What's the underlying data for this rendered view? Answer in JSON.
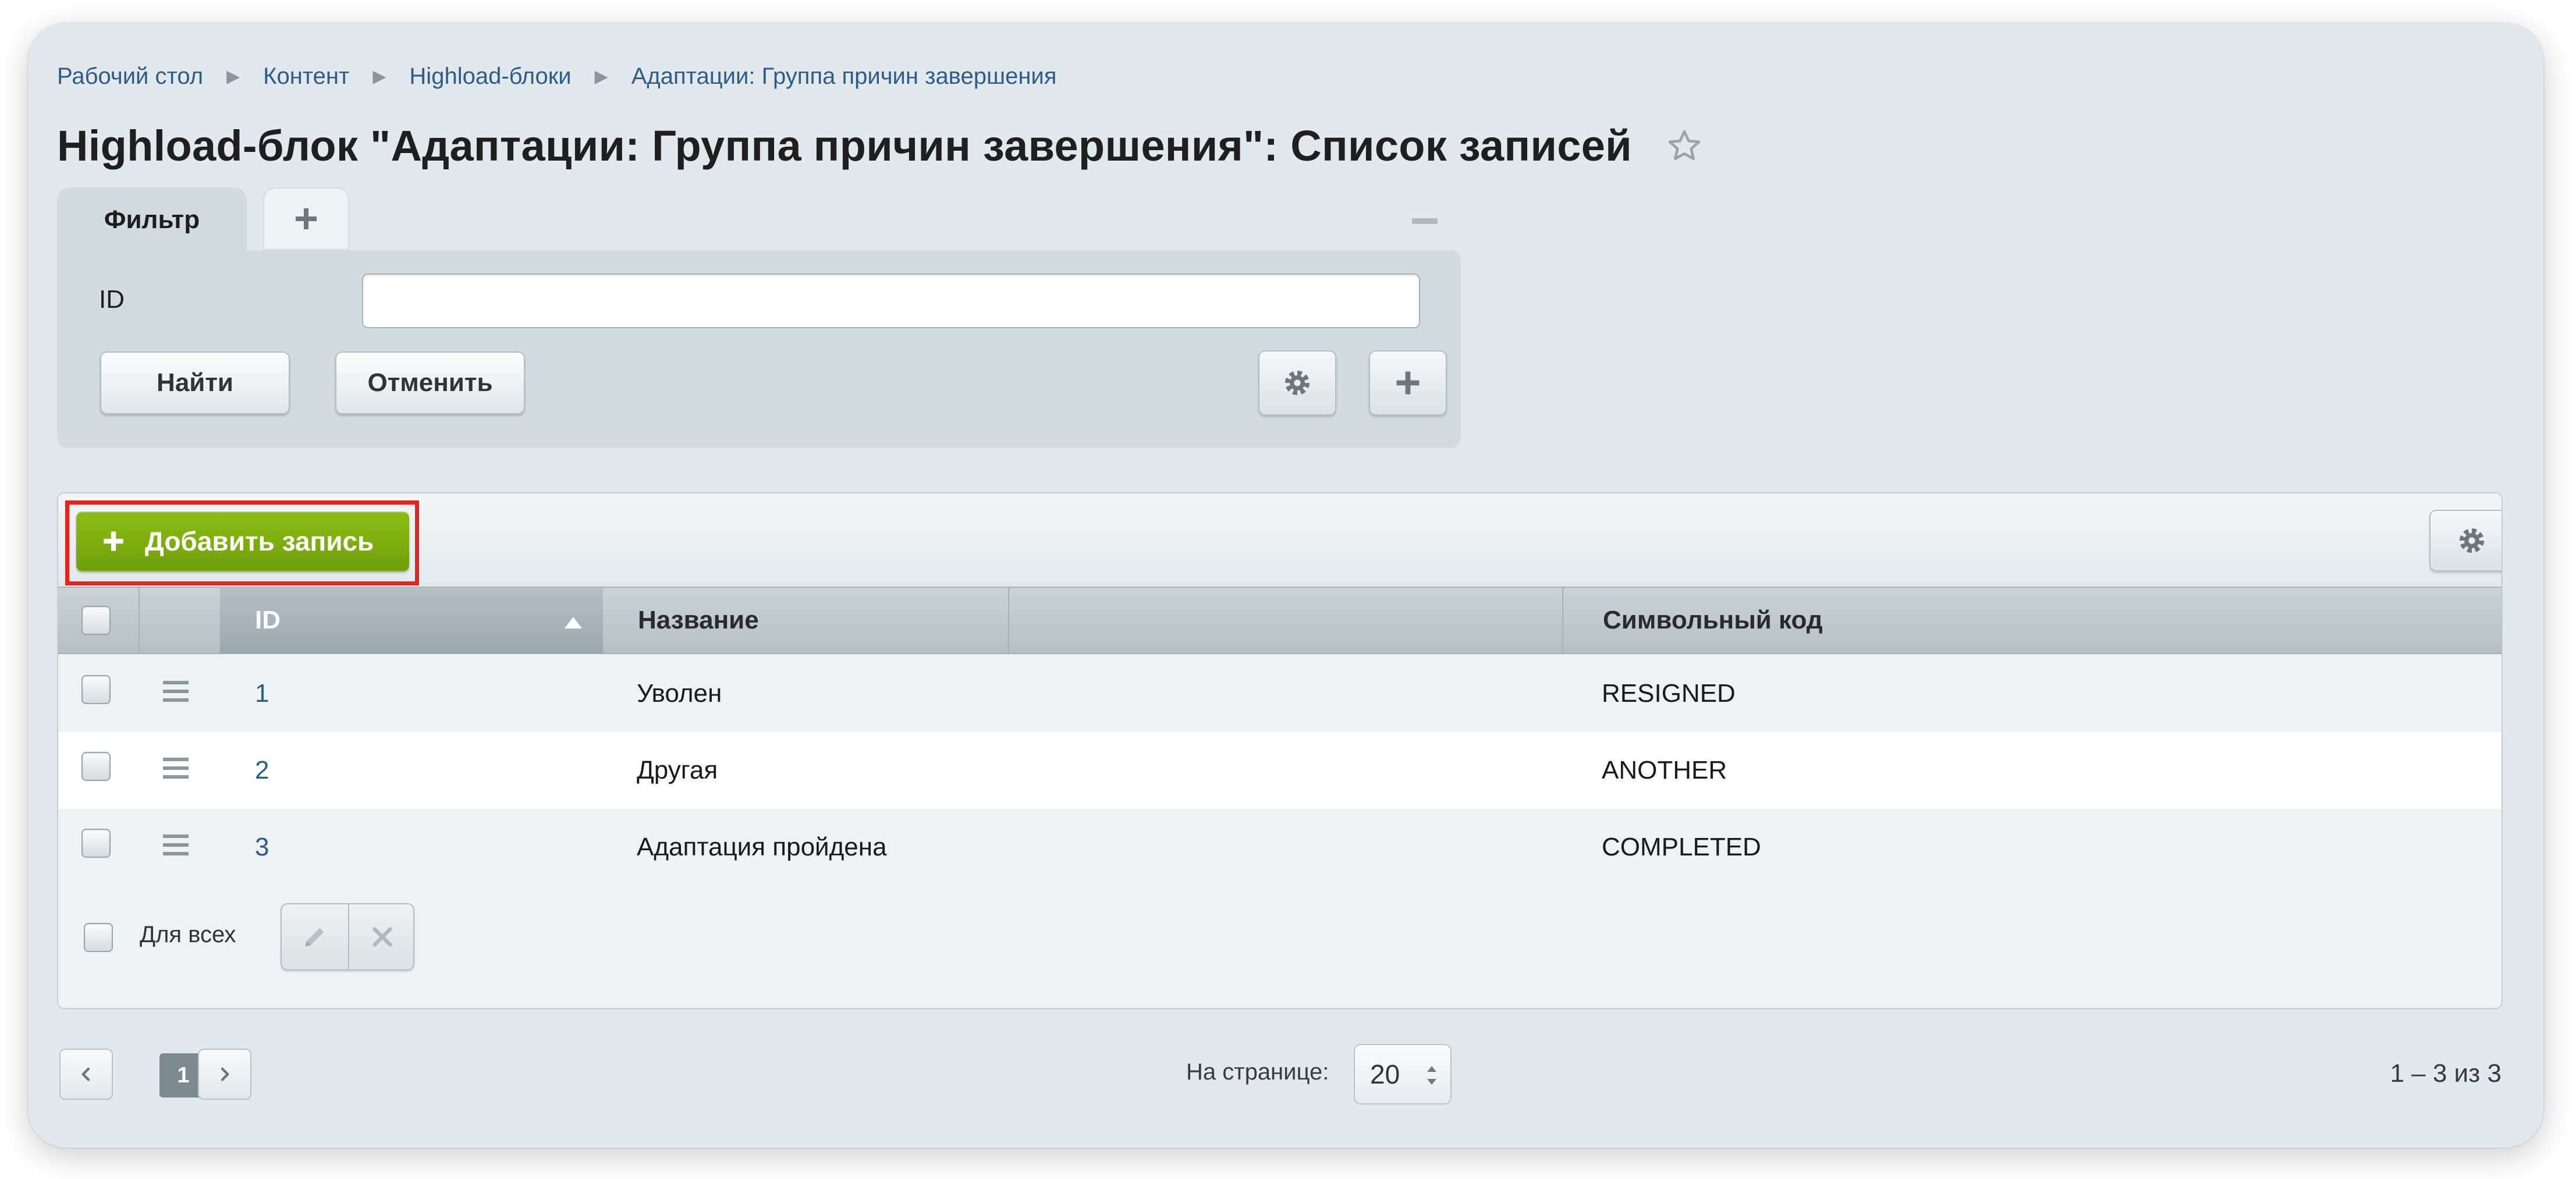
{
  "breadcrumbs": [
    "Рабочий стол",
    "Контент",
    "Highload-блоки",
    "Адаптации: Группа причин завершения"
  ],
  "page_title": "Highload-блок \"Адаптации: Группа причин завершения\": Список записей",
  "filter": {
    "tab_label": "Фильтр",
    "field_label": "ID",
    "field_value": "",
    "find_button": "Найти",
    "cancel_button": "Отменить"
  },
  "toolbar": {
    "add_button": "Добавить запись"
  },
  "table": {
    "columns": {
      "id": "ID",
      "name": "Название",
      "code": "Символьный код"
    },
    "rows": [
      {
        "id": "1",
        "name": "Уволен",
        "code": "RESIGNED"
      },
      {
        "id": "2",
        "name": "Другая",
        "code": "ANOTHER"
      },
      {
        "id": "3",
        "name": "Адаптация пройдена",
        "code": "COMPLETED"
      }
    ],
    "footer_for_all": "Для всех"
  },
  "pagination": {
    "current_page": "1",
    "per_page_label": "На странице:",
    "per_page_value": "20",
    "total_text": "1 – 3 из 3"
  },
  "colors": {
    "accent_green": "#7aab0e",
    "link_blue": "#2d5c8a",
    "highlight_red": "#e8231c"
  }
}
